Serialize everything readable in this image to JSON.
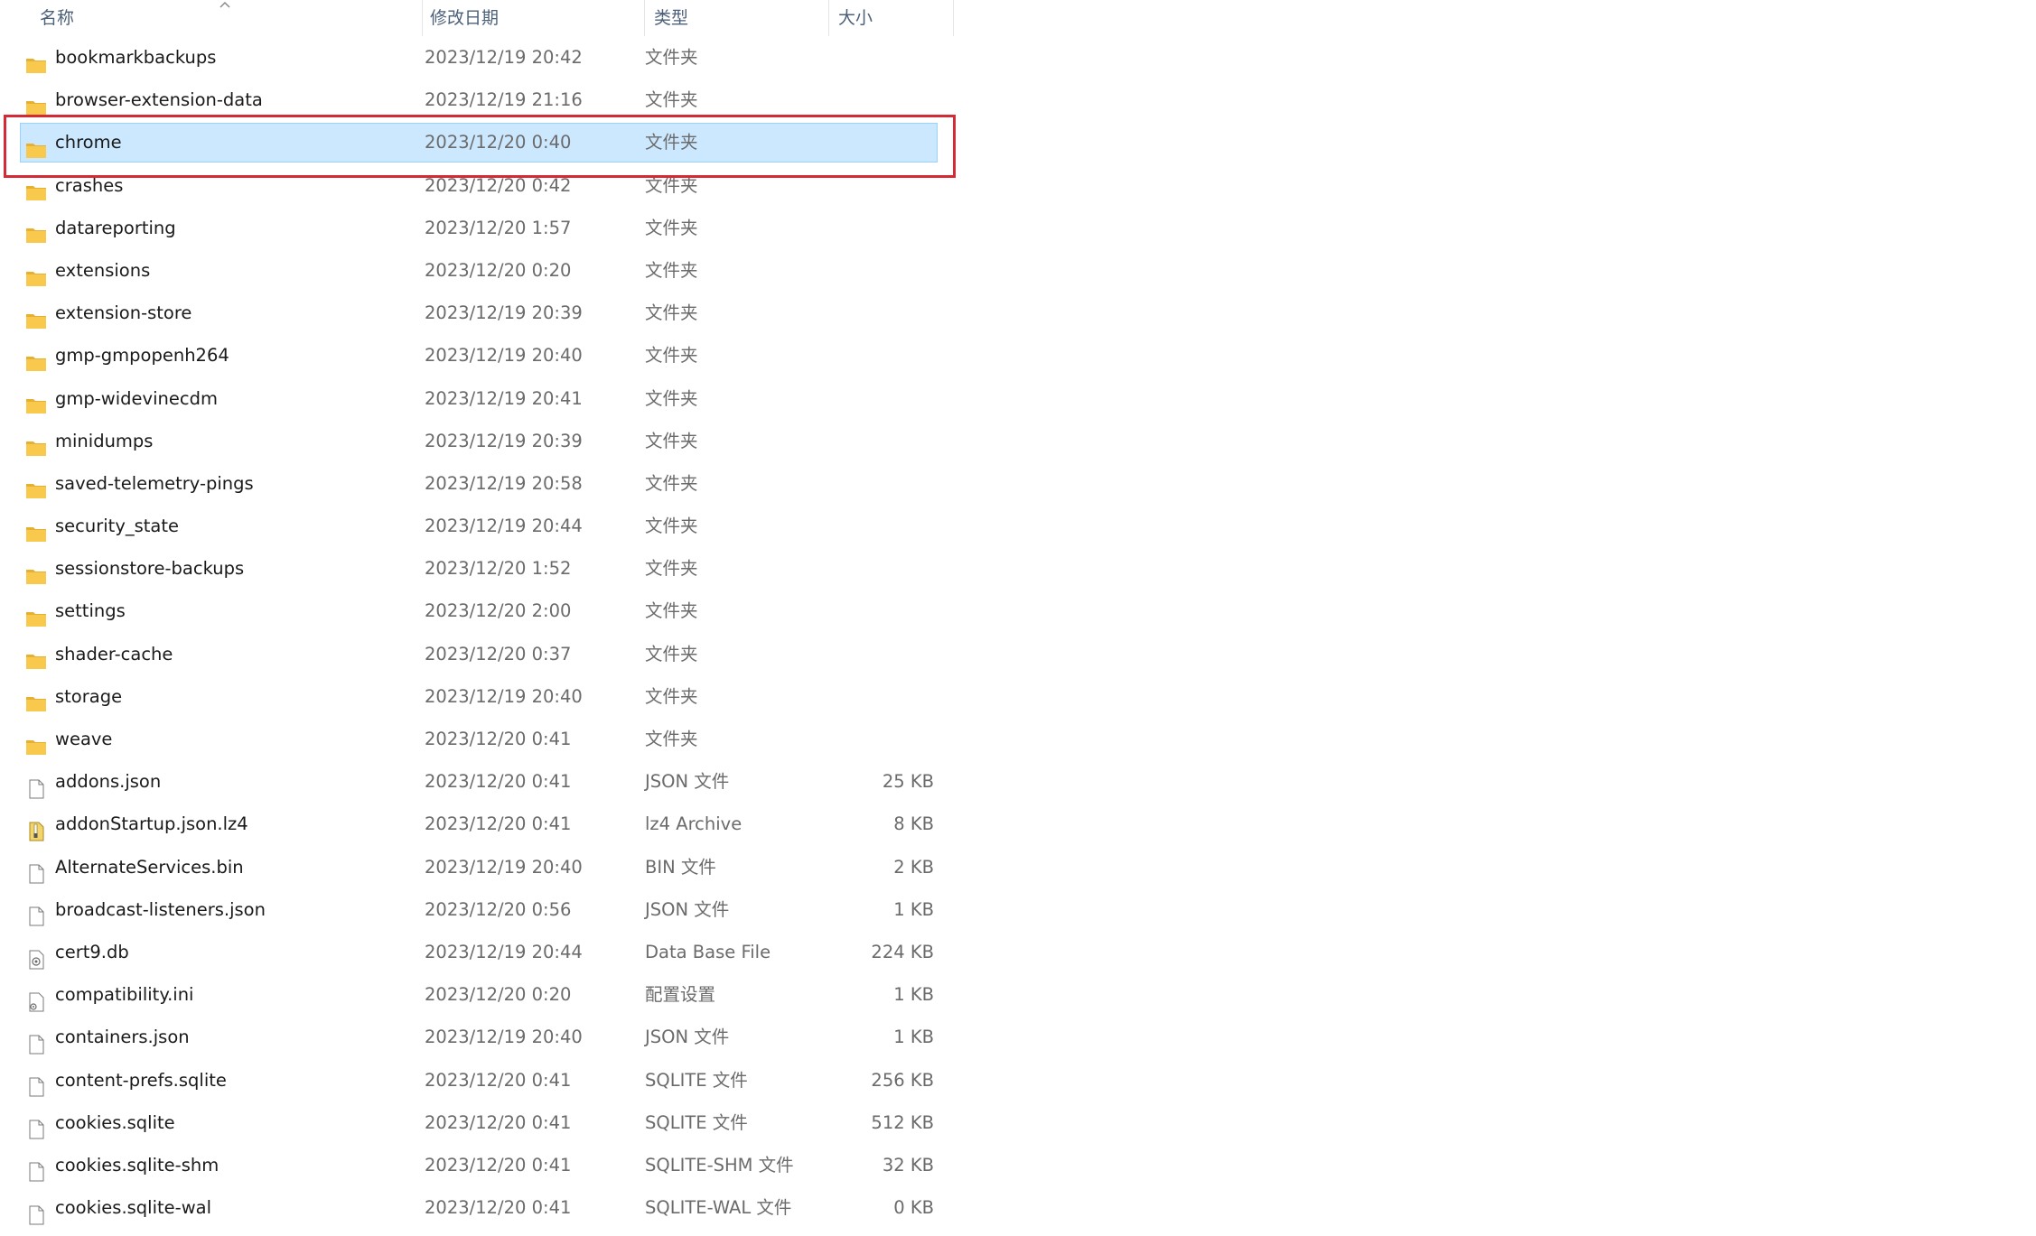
{
  "columns": {
    "name": "名称",
    "date": "修改日期",
    "type": "类型",
    "size": "大小"
  },
  "items": [
    {
      "name": "bookmarkbackups",
      "date": "2023/12/19 20:42",
      "type": "文件夹",
      "size": "",
      "icon": "folder-icon"
    },
    {
      "name": "browser-extension-data",
      "date": "2023/12/19 21:16",
      "type": "文件夹",
      "size": "",
      "icon": "folder-icon"
    },
    {
      "name": "chrome",
      "date": "2023/12/20 0:40",
      "type": "文件夹",
      "size": "",
      "icon": "folder-icon",
      "selected": true
    },
    {
      "name": "crashes",
      "date": "2023/12/20 0:42",
      "type": "文件夹",
      "size": "",
      "icon": "folder-icon"
    },
    {
      "name": "datareporting",
      "date": "2023/12/20 1:57",
      "type": "文件夹",
      "size": "",
      "icon": "folder-icon"
    },
    {
      "name": "extensions",
      "date": "2023/12/20 0:20",
      "type": "文件夹",
      "size": "",
      "icon": "folder-icon"
    },
    {
      "name": "extension-store",
      "date": "2023/12/19 20:39",
      "type": "文件夹",
      "size": "",
      "icon": "folder-icon"
    },
    {
      "name": "gmp-gmpopenh264",
      "date": "2023/12/19 20:40",
      "type": "文件夹",
      "size": "",
      "icon": "folder-icon"
    },
    {
      "name": "gmp-widevinecdm",
      "date": "2023/12/19 20:41",
      "type": "文件夹",
      "size": "",
      "icon": "folder-icon"
    },
    {
      "name": "minidumps",
      "date": "2023/12/19 20:39",
      "type": "文件夹",
      "size": "",
      "icon": "folder-icon"
    },
    {
      "name": "saved-telemetry-pings",
      "date": "2023/12/19 20:58",
      "type": "文件夹",
      "size": "",
      "icon": "folder-icon"
    },
    {
      "name": "security_state",
      "date": "2023/12/19 20:44",
      "type": "文件夹",
      "size": "",
      "icon": "folder-icon"
    },
    {
      "name": "sessionstore-backups",
      "date": "2023/12/20 1:52",
      "type": "文件夹",
      "size": "",
      "icon": "folder-icon"
    },
    {
      "name": "settings",
      "date": "2023/12/20 2:00",
      "type": "文件夹",
      "size": "",
      "icon": "folder-icon"
    },
    {
      "name": "shader-cache",
      "date": "2023/12/20 0:37",
      "type": "文件夹",
      "size": "",
      "icon": "folder-icon"
    },
    {
      "name": "storage",
      "date": "2023/12/19 20:40",
      "type": "文件夹",
      "size": "",
      "icon": "folder-icon"
    },
    {
      "name": "weave",
      "date": "2023/12/20 0:41",
      "type": "文件夹",
      "size": "",
      "icon": "folder-icon"
    },
    {
      "name": "addons.json",
      "date": "2023/12/20 0:41",
      "type": "JSON 文件",
      "size": "25 KB",
      "icon": "file-icon"
    },
    {
      "name": "addonStartup.json.lz4",
      "date": "2023/12/20 0:41",
      "type": "lz4 Archive",
      "size": "8 KB",
      "icon": "archive-icon"
    },
    {
      "name": "AlternateServices.bin",
      "date": "2023/12/19 20:40",
      "type": "BIN 文件",
      "size": "2 KB",
      "icon": "file-icon"
    },
    {
      "name": "broadcast-listeners.json",
      "date": "2023/12/20 0:56",
      "type": "JSON 文件",
      "size": "1 KB",
      "icon": "file-icon"
    },
    {
      "name": "cert9.db",
      "date": "2023/12/19 20:44",
      "type": "Data Base File",
      "size": "224 KB",
      "icon": "database-file-icon"
    },
    {
      "name": "compatibility.ini",
      "date": "2023/12/20 0:20",
      "type": "配置设置",
      "size": "1 KB",
      "icon": "settings-file-icon"
    },
    {
      "name": "containers.json",
      "date": "2023/12/19 20:40",
      "type": "JSON 文件",
      "size": "1 KB",
      "icon": "file-icon"
    },
    {
      "name": "content-prefs.sqlite",
      "date": "2023/12/20 0:41",
      "type": "SQLITE 文件",
      "size": "256 KB",
      "icon": "file-icon"
    },
    {
      "name": "cookies.sqlite",
      "date": "2023/12/20 0:41",
      "type": "SQLITE 文件",
      "size": "512 KB",
      "icon": "file-icon"
    },
    {
      "name": "cookies.sqlite-shm",
      "date": "2023/12/20 0:41",
      "type": "SQLITE-SHM 文件",
      "size": "32 KB",
      "icon": "file-icon"
    },
    {
      "name": "cookies.sqlite-wal",
      "date": "2023/12/20 0:41",
      "type": "SQLITE-WAL 文件",
      "size": "0 KB",
      "icon": "file-icon"
    }
  ],
  "colors": {
    "selection_bg": "#cce8ff",
    "selection_border": "#99d1ff",
    "highlight_box": "#d42a36",
    "folder": "#f8c94c"
  }
}
